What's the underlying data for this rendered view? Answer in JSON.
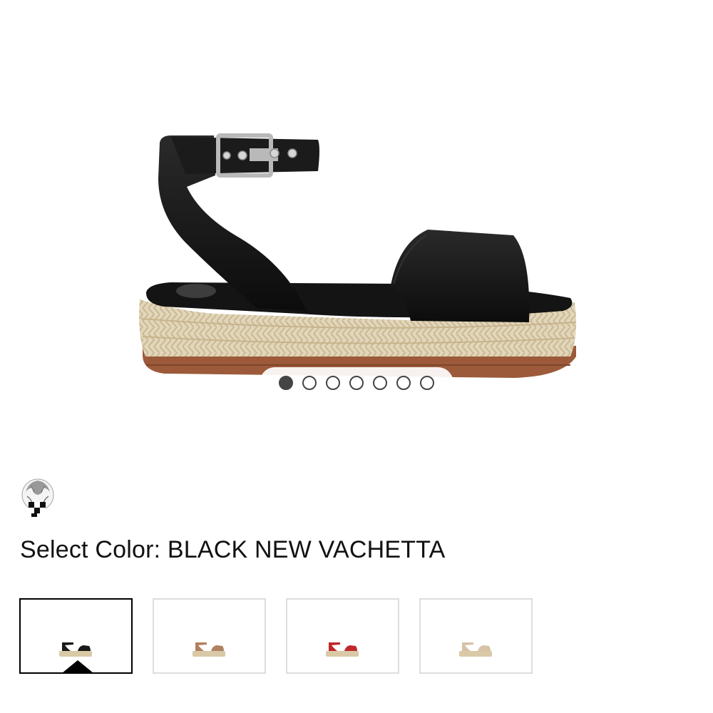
{
  "product": {
    "image_icon": "sandal-product-image",
    "gallery": {
      "count": 7,
      "active_index": 0
    }
  },
  "brand": {
    "logo_icon": "lion-crest-logo-icon"
  },
  "color_selector": {
    "label": "Select Color:",
    "selected_value": "BLACK NEW VACHETTA",
    "swatches": [
      {
        "strap_color": "#1a1a1a",
        "sole_color": "#d9c9a6",
        "selected": true
      },
      {
        "strap_color": "#b08060",
        "sole_color": "#d9c9a6",
        "selected": false
      },
      {
        "strap_color": "#c0282a",
        "sole_color": "#d9c9a6",
        "selected": false
      },
      {
        "strap_color": "#d8c2a6",
        "sole_color": "#d9c9a6",
        "selected": false
      }
    ]
  },
  "colors": {
    "strap": "#151515",
    "jute": "#ddd0b2",
    "jute_shadow": "#c8b793",
    "outsole": "#9c5a3a",
    "buckle": "#b9b9b9",
    "dot": "#444444"
  }
}
